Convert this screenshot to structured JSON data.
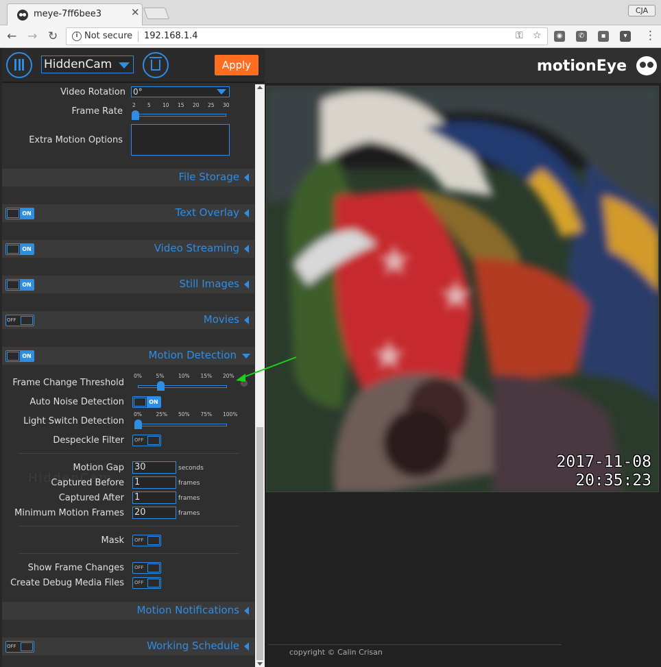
{
  "browser": {
    "tab_title": "meye-7ff6bee3",
    "profile": "CJA",
    "security": "Not secure",
    "url": "192.168.1.4"
  },
  "header": {
    "camera": "HiddenCam",
    "apply": "Apply",
    "brand": "motionEye"
  },
  "video_device": {
    "rotation_label": "Video Rotation",
    "rotation_value": "0°",
    "framerate_label": "Frame Rate",
    "framerate_ticks": [
      "2",
      "5",
      "10",
      "15",
      "20",
      "25",
      "30"
    ],
    "framerate_value": 2,
    "extra_label": "Extra Motion Options"
  },
  "sections": {
    "file_storage": "File Storage",
    "text_overlay": "Text Overlay",
    "video_streaming": "Video Streaming",
    "still_images": "Still Images",
    "movies": "Movies",
    "motion_detection": "Motion Detection",
    "motion_notifications": "Motion Notifications",
    "working_schedule": "Working Schedule"
  },
  "toggles": {
    "on": "ON",
    "off": "OFF",
    "text_overlay": true,
    "video_streaming": true,
    "still_images": true,
    "movies": false,
    "motion_detection": true,
    "working_schedule": false
  },
  "motion": {
    "threshold_label": "Frame Change Threshold",
    "threshold_ticks": [
      "0%",
      "5%",
      "10%",
      "15%",
      "20%"
    ],
    "threshold_value_pct": 5,
    "auto_noise_label": "Auto Noise Detection",
    "auto_noise": true,
    "light_switch_label": "Light Switch Detection",
    "light_switch_ticks": [
      "0%",
      "25%",
      "50%",
      "75%",
      "100%"
    ],
    "light_switch_value_pct": 0,
    "despeckle_label": "Despeckle Filter",
    "despeckle": false,
    "gap_label": "Motion Gap",
    "gap_value": "30",
    "gap_unit": "seconds",
    "before_label": "Captured Before",
    "before_value": "1",
    "before_unit": "frames",
    "after_label": "Captured After",
    "after_value": "1",
    "after_unit": "frames",
    "min_frames_label": "Minimum Motion Frames",
    "min_frames_value": "20",
    "min_frames_unit": "frames",
    "mask_label": "Mask",
    "mask": false,
    "show_changes_label": "Show Frame Changes",
    "show_changes": false,
    "debug_label": "Create Debug Media Files",
    "debug": false,
    "watermark": "HiddenCam",
    "help": "?"
  },
  "camera_frame": {
    "date": "2017-11-08",
    "time": "20:35:23"
  },
  "footer": {
    "copyright": "copyright © Calin Crisan"
  },
  "colors": {
    "accent": "#2f8de4",
    "apply": "#ff6d20",
    "annotation_arrow": "#19d219"
  }
}
